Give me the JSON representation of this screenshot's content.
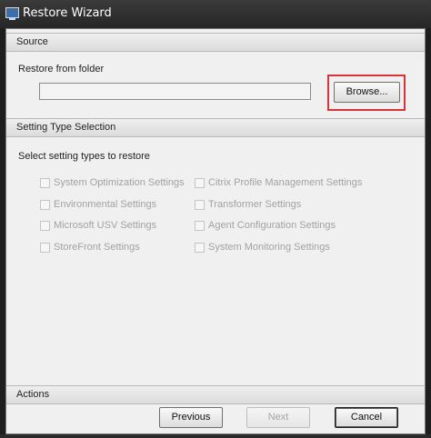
{
  "window": {
    "title": "Restore Wizard",
    "icon": "window-app-icon"
  },
  "source": {
    "header": "Source",
    "restore_label": "Restore from folder",
    "folder_value": "",
    "browse_label": "Browse...",
    "highlight_color": "#d8353a"
  },
  "setting_types": {
    "header": "Setting Type Selection",
    "prompt": "Select setting types to restore",
    "options": [
      {
        "label": "System Optimization Settings",
        "checked": false,
        "enabled": false
      },
      {
        "label": "Environmental Settings",
        "checked": false,
        "enabled": false
      },
      {
        "label": "Microsoft USV Settings",
        "checked": false,
        "enabled": false
      },
      {
        "label": "StoreFront Settings",
        "checked": false,
        "enabled": false
      },
      {
        "label": "Citrix Profile Management Settings",
        "checked": false,
        "enabled": false
      },
      {
        "label": "Transformer Settings",
        "checked": false,
        "enabled": false
      },
      {
        "label": "Agent Configuration Settings",
        "checked": false,
        "enabled": false
      },
      {
        "label": "System Monitoring Settings",
        "checked": false,
        "enabled": false
      }
    ]
  },
  "actions": {
    "header": "Actions",
    "previous_label": "Previous",
    "next_label": "Next",
    "next_enabled": false,
    "cancel_label": "Cancel"
  }
}
